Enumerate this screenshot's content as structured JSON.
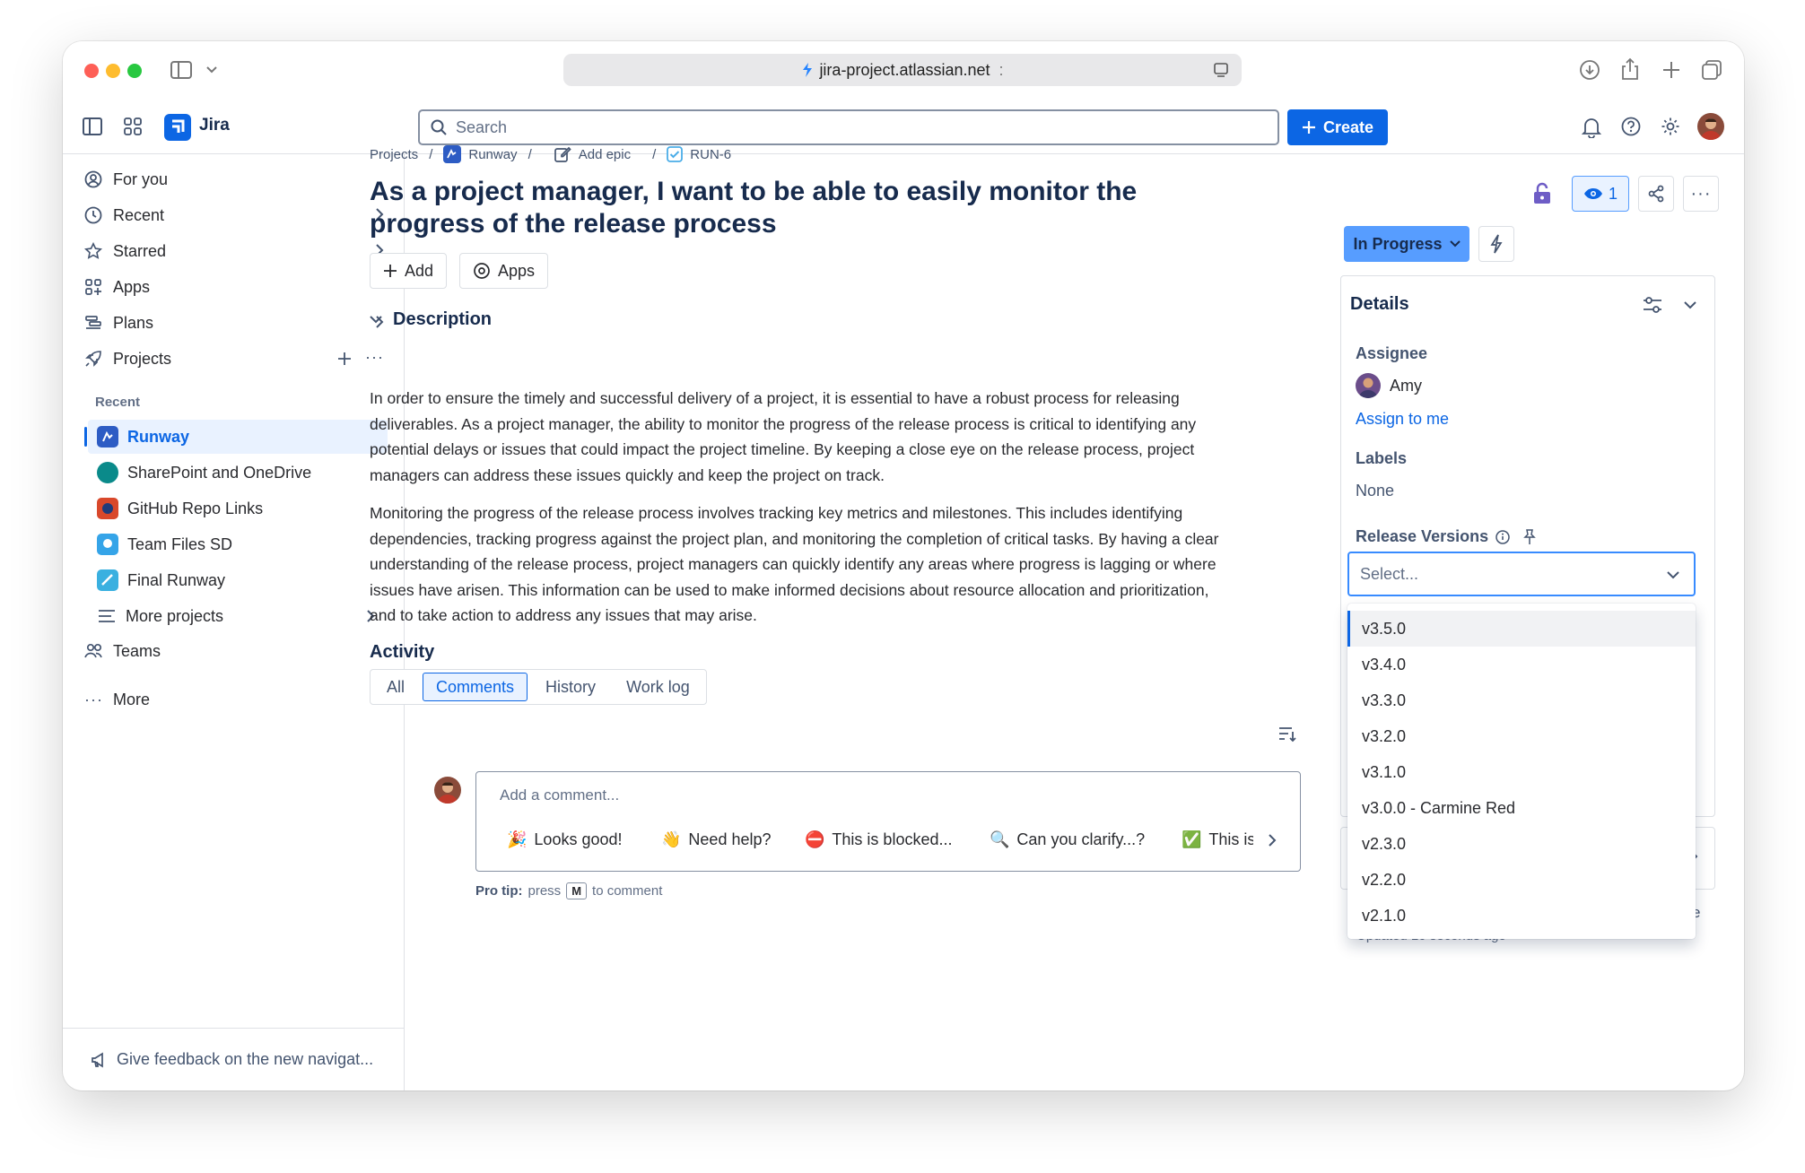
{
  "browser": {
    "url": "jira-project.atlassian.net",
    "url_suffix": ":"
  },
  "header": {
    "app_name": "Jira",
    "search_placeholder": "Search",
    "create_label": "Create"
  },
  "sidebar": {
    "items": [
      {
        "label": "For you",
        "icon": "user-circle-icon"
      },
      {
        "label": "Recent",
        "icon": "clock-icon"
      },
      {
        "label": "Starred",
        "icon": "star-icon"
      },
      {
        "label": "Apps",
        "icon": "apps-icon"
      },
      {
        "label": "Plans",
        "icon": "plans-icon"
      },
      {
        "label": "Projects",
        "icon": "rocket-icon"
      }
    ],
    "recent_label": "Recent",
    "projects": [
      {
        "label": "Runway",
        "color": "#2d5cc4"
      },
      {
        "label": "SharePoint and OneDrive",
        "color": "#0a8a8a"
      },
      {
        "label": "GitHub Repo Links",
        "color": "#d9482b"
      },
      {
        "label": "Team Files SD",
        "color": "#35a4e8"
      },
      {
        "label": "Final Runway",
        "color": "#3ab0e0"
      }
    ],
    "more_projects": "More projects",
    "teams": "Teams",
    "more": "More",
    "feedback": "Give feedback on the new navigat..."
  },
  "breadcrumb": {
    "projects": "Projects",
    "runway": "Runway",
    "add_epic": "Add epic",
    "issue_key": "RUN-6"
  },
  "issue": {
    "title": "As a project manager, I want to be able to easily monitor the progress of the release process",
    "add_label": "Add",
    "apps_label": "Apps",
    "description_heading": "Description",
    "description_p1": "In order to ensure the timely and successful delivery of a project, it is essential to have a robust process for releasing deliverables. As a project manager, the ability to monitor the progress of the release process is critical to identifying any potential delays or issues that could impact the project timeline. By keeping a close eye on the release process, project managers can address these issues quickly and keep the project on track.",
    "description_p2": "Monitoring the progress of the release process involves tracking key metrics and milestones. This includes identifying dependencies, tracking progress against the project plan, and monitoring the completion of critical tasks. By having a clear understanding of the release process, project managers can quickly identify any areas where progress is lagging or where issues have arisen. This information can be used to make informed decisions about resource allocation and prioritization, and to take action to address any issues that may arise."
  },
  "activity": {
    "heading": "Activity",
    "tabs": [
      "All",
      "Comments",
      "History",
      "Work log"
    ],
    "active_tab": "Comments",
    "comment_placeholder": "Add a comment...",
    "quick_replies": [
      {
        "emoji": "🎉",
        "text": "Looks good!"
      },
      {
        "emoji": "👋",
        "text": "Need help?"
      },
      {
        "emoji": "⛔",
        "text": "This is blocked..."
      },
      {
        "emoji": "🔍",
        "text": "Can you clarify...?"
      },
      {
        "emoji": "✅",
        "text": "This is"
      }
    ],
    "pro_tip_bold": "Pro tip:",
    "pro_tip_press": "press",
    "pro_tip_key": "M",
    "pro_tip_rest": "to comment"
  },
  "right_panel": {
    "watch_count": "1",
    "status": "In Progress",
    "details_heading": "Details",
    "assignee_label": "Assignee",
    "assignee_name": "Amy",
    "assign_to_me": "Assign to me",
    "labels_label": "Labels",
    "labels_value": "None",
    "release_versions_label": "Release Versions",
    "select_placeholder": "Select...",
    "version_options": [
      "v3.5.0",
      "v3.4.0",
      "v3.3.0",
      "v3.2.0",
      "v3.1.0",
      "v3.0.0 - Carmine Red",
      "v2.3.0",
      "v2.2.0",
      "v2.1.0"
    ],
    "highlighted_option": "v3.5.0",
    "partial_updated": "Updated 10 seconds ago",
    "partial_right_char": "e"
  },
  "colors": {
    "brand_blue": "#0c66e4",
    "status_blue": "#579dff",
    "lock_purple": "#6e5dc6"
  }
}
